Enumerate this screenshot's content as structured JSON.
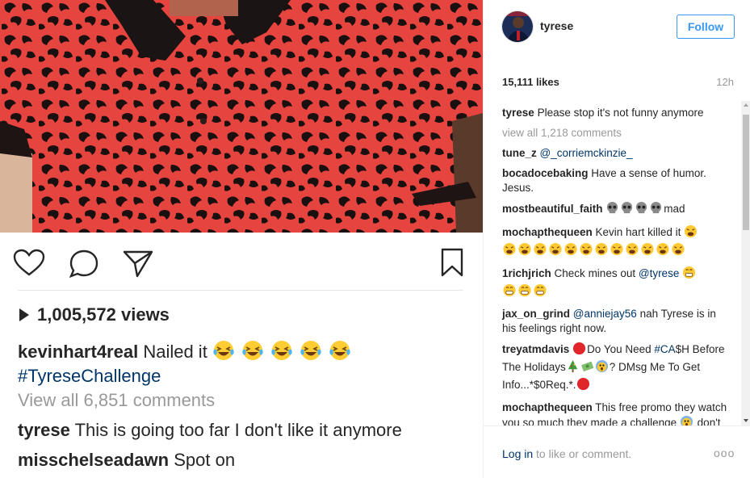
{
  "post": {
    "views_count": "1,005,572 views",
    "caption": {
      "username": "kevinhart4real",
      "text": "Nailed it",
      "hashtag": "#TyreseChallenge"
    },
    "view_all_comments": "View all 6,851 comments",
    "preview_comments": [
      {
        "username": "tyrese",
        "text": "This is going too far I don't like it anymore"
      },
      {
        "username": "misschelseadawn",
        "text": "Spot on"
      }
    ]
  },
  "panel": {
    "header": {
      "username": "tyrese",
      "follow_label": "Follow"
    },
    "likes": "15,111 likes",
    "time": "12h",
    "caption": {
      "username": "tyrese",
      "text": "Please stop it's not funny anymore"
    },
    "view_all_comments": "view all 1,218 comments",
    "comments": [
      {
        "username": "tune_z",
        "mention": "@_corriemckinzie_"
      },
      {
        "username": "bocadocebaking",
        "text": "Have a sense of humor. Jesus."
      },
      {
        "username": "mostbeautiful_faith",
        "text": "mad"
      },
      {
        "username": "mochapthequeen",
        "text": "Kevin hart killed it"
      },
      {
        "username": "1richjrich",
        "text": "Check mines out",
        "mention": "@tyrese"
      },
      {
        "username": "jax_on_grind",
        "mention": "@anniejay56",
        "text": "nah Tyrese is in his feelings right now."
      },
      {
        "username": "treyatmdavis",
        "text_a": "Do You Need",
        "hashtag": "#CA",
        "text_b": "$H Before The Holidays",
        "text_c": "? DMsg Me To Get Info...*$0Req.*."
      },
      {
        "username": "mochapthequeen",
        "text": "This free promo they watch you so much they made a challenge",
        "text_b": "don't get mad be flattered"
      }
    ],
    "footer": {
      "login_link": "Log in",
      "login_text": "to like or comment.",
      "more": "ooo"
    }
  },
  "colors": {
    "accent": "#3897f0",
    "link": "#003569",
    "muted": "#999999",
    "shirt_red": "#e6443f"
  },
  "icons": [
    "heart-icon",
    "comment-icon",
    "share-icon",
    "bookmark-icon",
    "play-icon",
    "laughing-emoji",
    "skull-emoji",
    "tired-emoji",
    "grin-emoji",
    "red-circle-emoji",
    "tree-emoji",
    "money-emoji",
    "scream-emoji",
    "ellipsis-icon"
  ]
}
